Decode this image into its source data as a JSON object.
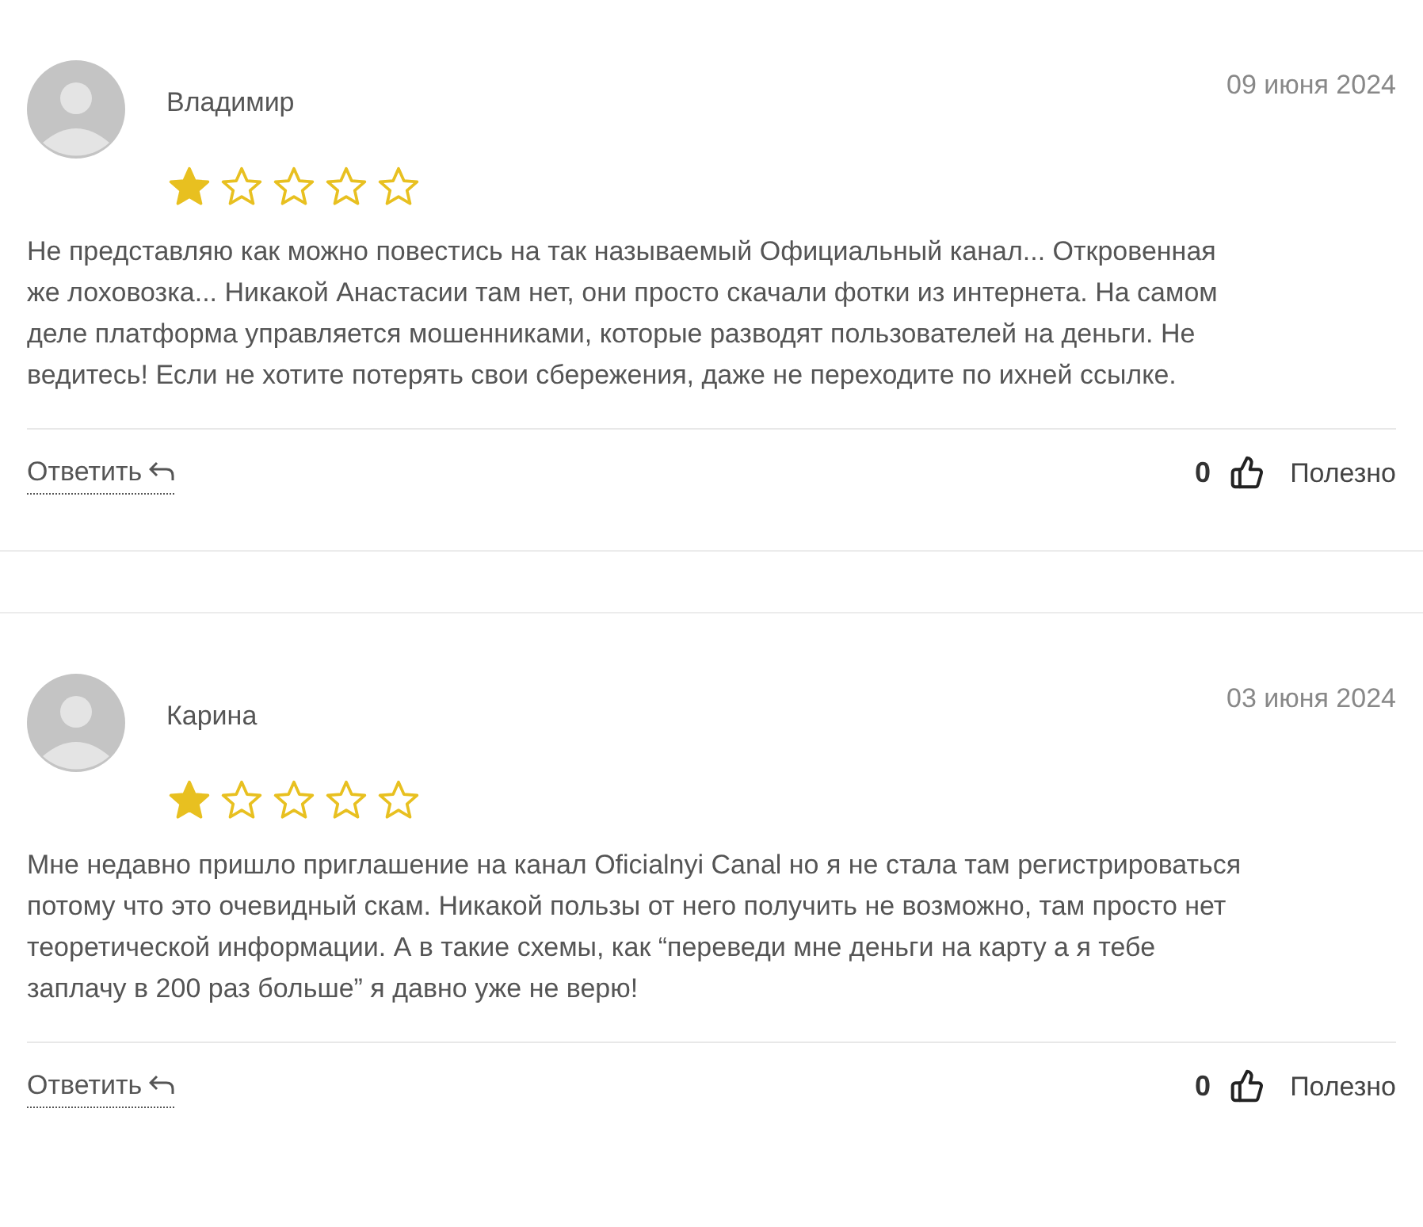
{
  "reviews": [
    {
      "author": "Владимир",
      "date": "09 июня 2024",
      "stars": 1,
      "text": "Не представляю как можно повестись на так называемый Официальный канал... Откровенная же лоховозка... Никакой Анастасии там нет, они просто скачали фотки из интернета. На самом деле платформа управляется мошенниками, которые разводят пользователей на деньги. Не ведитесь! Если не хотите потерять свои сбережения, даже не переходите по ихней ссылке.",
      "reply": "Ответить",
      "likes": "0",
      "helpful": "Полезно"
    },
    {
      "author": "Карина",
      "date": "03 июня 2024",
      "stars": 1,
      "text": "Мне недавно пришло приглашение на канал Oficialnyi Canal но я не стала там регистрироваться потому что это очевидный скам. Никакой пользы от него получить не возможно, там просто нет теоретической информации. А в такие схемы, как “переведи мне деньги на карту а я тебе заплачу в 200 раз больше” я давно уже не верю!",
      "reply": "Ответить",
      "likes": "0",
      "helpful": "Полезно"
    }
  ]
}
